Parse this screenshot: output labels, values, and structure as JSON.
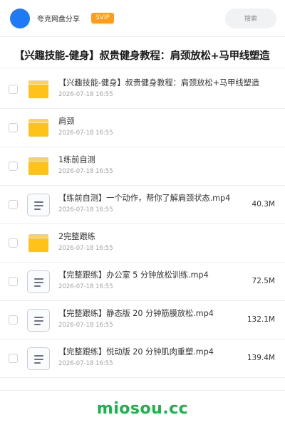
{
  "header": {
    "username": "夸克网盘分享",
    "badge": "SVIP",
    "search_label": "搜索",
    "colors": {
      "avatar": "#1e7bf5",
      "badge": "#ff9c1a"
    }
  },
  "page_title": "【兴趣技能-健身】叔贵健身教程：肩颈放松+马甲线塑造",
  "files": [
    {
      "type": "folder",
      "icon": "folder-icon",
      "name": "【兴趣技能-健身】叔贵健身教程：肩颈放松+马甲线塑造",
      "date": "2026-07-18 16:55",
      "size": ""
    },
    {
      "type": "folder",
      "icon": "folder-icon",
      "name": "肩颈",
      "date": "2026-07-18 16:55",
      "size": ""
    },
    {
      "type": "folder",
      "icon": "folder-icon",
      "name": "1练前自测",
      "date": "2026-07-18 16:55",
      "size": ""
    },
    {
      "type": "file",
      "icon": "document-icon",
      "name": "【练前自测】一个动作，帮你了解肩颈状态.mp4",
      "date": "2026-07-18 16:55",
      "size": "40.3M"
    },
    {
      "type": "folder",
      "icon": "folder-icon",
      "name": "2完整跟练",
      "date": "2026-07-18 16:55",
      "size": ""
    },
    {
      "type": "file",
      "icon": "document-icon",
      "name": "【完整跟练】办公室 5 分钟放松训练.mp4",
      "date": "2026-07-18 16:55",
      "size": "72.5M"
    },
    {
      "type": "file",
      "icon": "document-icon",
      "name": "【完整跟练】静态版 20 分钟筋膜放松.mp4",
      "date": "2026-07-18 16:55",
      "size": "132.1M"
    },
    {
      "type": "file",
      "icon": "document-icon",
      "name": "【完整跟练】悦动版 20 分钟肌肉重塑.mp4",
      "date": "2026-07-18 16:55",
      "size": "139.4M"
    }
  ],
  "footer": {
    "logo_text": "miosou.cc",
    "logo_color": "#19b34a"
  }
}
